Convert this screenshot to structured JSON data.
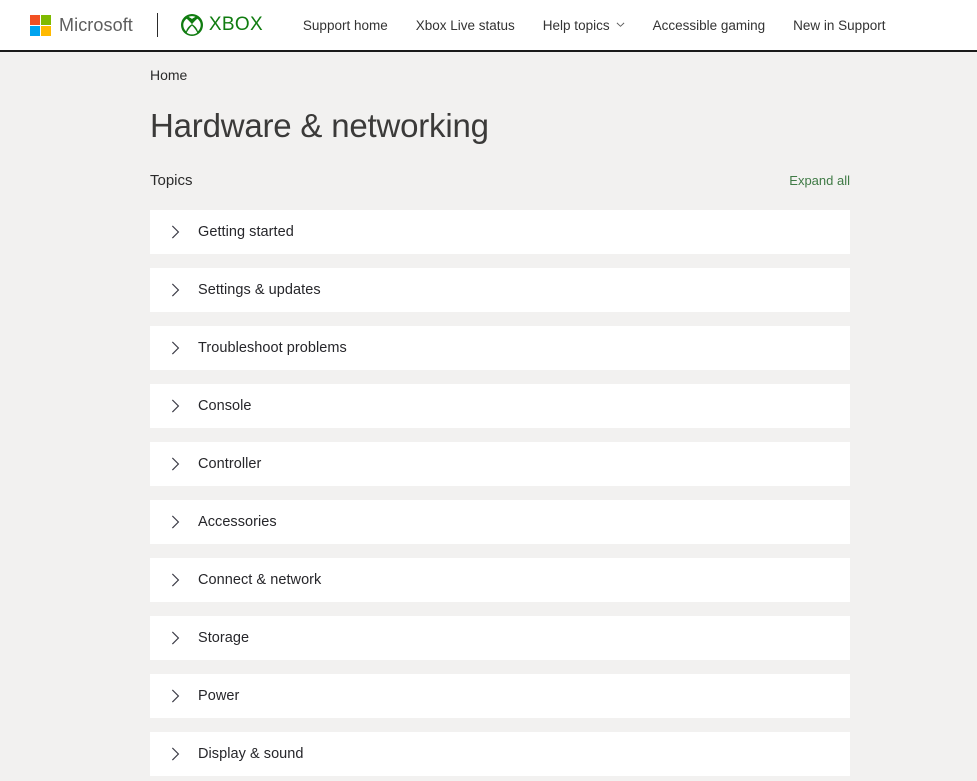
{
  "header": {
    "microsoft_logo_text": "Microsoft",
    "xbox_logo_text": "XBOX",
    "nav": [
      {
        "label": "Support home",
        "has_chevron": false
      },
      {
        "label": "Xbox Live status",
        "has_chevron": false
      },
      {
        "label": "Help topics",
        "has_chevron": true
      },
      {
        "label": "Accessible gaming",
        "has_chevron": false
      },
      {
        "label": "New in Support",
        "has_chevron": false
      }
    ]
  },
  "breadcrumb": {
    "items": [
      "Home"
    ]
  },
  "main": {
    "title": "Hardware & networking",
    "topics_label": "Topics",
    "expand_all_label": "Expand all",
    "topics": [
      {
        "label": "Getting started"
      },
      {
        "label": "Settings & updates"
      },
      {
        "label": "Troubleshoot problems"
      },
      {
        "label": "Console"
      },
      {
        "label": "Controller"
      },
      {
        "label": "Accessories"
      },
      {
        "label": "Connect & network"
      },
      {
        "label": "Storage"
      },
      {
        "label": "Power"
      },
      {
        "label": "Display & sound"
      }
    ]
  },
  "colors": {
    "page_background": "#f2f1f0",
    "card_background": "#ffffff",
    "xbox_green": "#107c10",
    "expand_all_green": "#3f7a45",
    "text_primary": "#26262a",
    "title_gray": "#3b3a39",
    "ms_red": "#f25022",
    "ms_green": "#7fba00",
    "ms_blue": "#00a4ef",
    "ms_yellow": "#ffb900"
  },
  "icons": {
    "microsoft_logo": "microsoft-logo-icon",
    "xbox_logo": "xbox-logo-icon",
    "nav_dropdown": "chevron-down-icon",
    "accordion_expand": "chevron-right-icon"
  }
}
